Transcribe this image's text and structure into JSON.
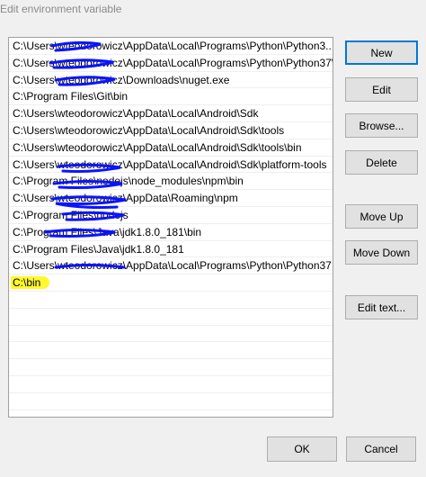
{
  "window": {
    "title": "Edit environment variable"
  },
  "path_list": {
    "entries": [
      "C:\\Users\\wteodorowicz\\AppData\\Local\\Programs\\Python\\Python3...",
      "C:\\Users\\wteodorowicz\\AppData\\Local\\Programs\\Python\\Python37\\",
      "C:\\Users\\wteodorowicz\\Downloads\\nuget.exe",
      "C:\\Program Files\\Git\\bin",
      "C:\\Users\\wteodorowicz\\AppData\\Local\\Android\\Sdk",
      "C:\\Users\\wteodorowicz\\AppData\\Local\\Android\\Sdk\\tools",
      "C:\\Users\\wteodorowicz\\AppData\\Local\\Android\\Sdk\\tools\\bin",
      "C:\\Users\\wteodorowicz\\AppData\\Local\\Android\\Sdk\\platform-tools",
      "C:\\Program Files\\nodejs\\node_modules\\npm\\bin",
      "C:\\Users\\wteodorowicz\\AppData\\Roaming\\npm",
      "C:\\Program Files\\nodejs",
      "C:\\Program Files\\Java\\jdk1.8.0_181\\bin",
      "C:\\Program Files\\Java\\jdk1.8.0_181",
      "C:\\Users\\wteodorowicz\\AppData\\Local\\Programs\\Python\\Python37",
      "C:\\bin"
    ],
    "selected_entry": "C:\\bin",
    "highlight_color": "#fff82e",
    "redaction_color": "#0a14ff"
  },
  "buttons": {
    "new": "New",
    "edit": "Edit",
    "browse": "Browse...",
    "delete": "Delete",
    "move_up": "Move Up",
    "move_down": "Move Down",
    "edit_text": "Edit text...",
    "ok": "OK",
    "cancel": "Cancel"
  }
}
